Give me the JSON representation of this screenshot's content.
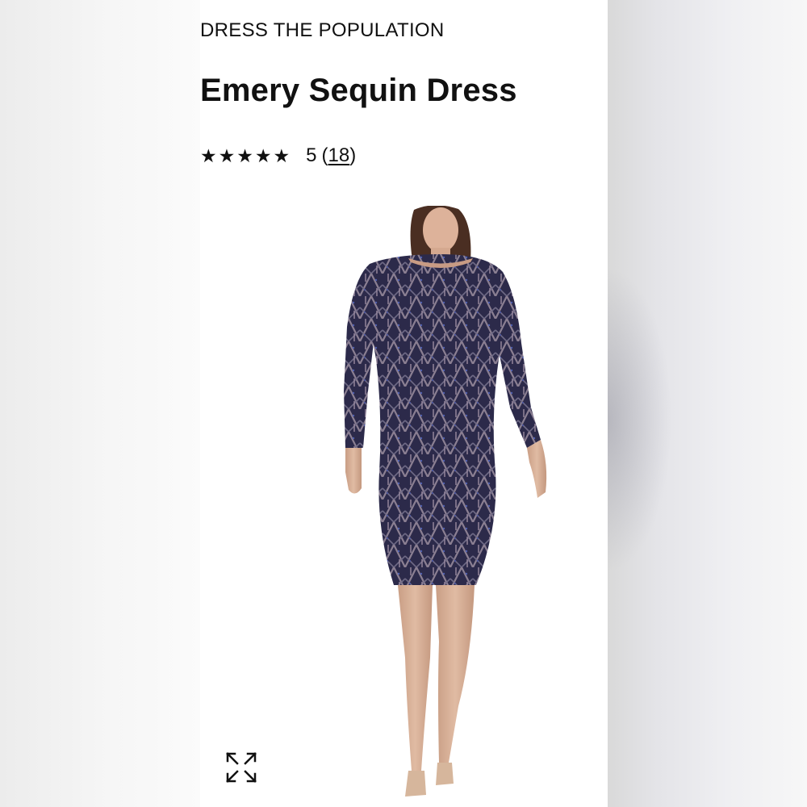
{
  "product": {
    "brand": "DRESS THE POPULATION",
    "title": "Emery Sequin Dress",
    "rating": {
      "stars_filled": 5,
      "stars_total": 5,
      "score": "5",
      "review_count": "18"
    },
    "image_icon": "model-in-dress-photo",
    "expand_icon": "expand-icon"
  }
}
